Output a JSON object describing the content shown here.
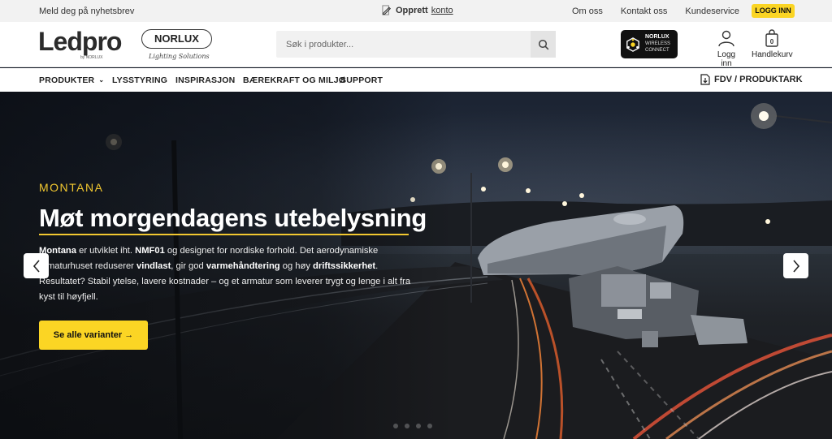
{
  "topbar": {
    "newsletter": "Meld deg på nyhetsbrev",
    "create_prefix": "Opprett",
    "create_link": "konto",
    "links": [
      "Om oss",
      "Kontakt oss",
      "Kundeservice"
    ],
    "login": "LOGG INN"
  },
  "header": {
    "logo_ledpro": "Ledpro",
    "logo_ledpro_by": "by NORLUX",
    "logo_norlux": "NORLUX",
    "logo_norlux_tagline": "Lighting Solutions",
    "search_placeholder": "Søk i produkter...",
    "wireless_line1": "NORLUX",
    "wireless_line2": "WIRELESS",
    "wireless_line3": "CONNECT",
    "login_label": "Logg inn",
    "cart_label": "Handlekurv",
    "cart_count": "0"
  },
  "nav": {
    "items": [
      "PRODUKTER",
      "LYSSTYRING",
      "INSPIRASJON",
      "BÆREKRAFT OG MILJØ",
      "SUPPORT"
    ],
    "fdv": "FDV / PRODUKTARK"
  },
  "hero": {
    "eyebrow": "MONTANA",
    "headline": "Møt morgendagens utebelysning",
    "body": {
      "p1": "Montana",
      "p2": " er utviklet iht. ",
      "p3": "NMF01",
      "p4": " og designet for nordiske forhold. Det aerodynamiske armaturhuset reduserer ",
      "p5": "vindlast",
      "p6": ", gir god ",
      "p7": "varmehåndtering",
      "p8": " og høy ",
      "p9": "driftssikkerhet",
      "p10": ". Resultatet? Stabil ytelse, lavere kostnader – og et armatur som leverer trygt og lenge i alt fra kyst til høyfjell."
    },
    "cta": "Se alle varianter →",
    "slides": 4
  },
  "colors": {
    "accent": "#fbd524",
    "headline_accent": "#f2c830"
  }
}
